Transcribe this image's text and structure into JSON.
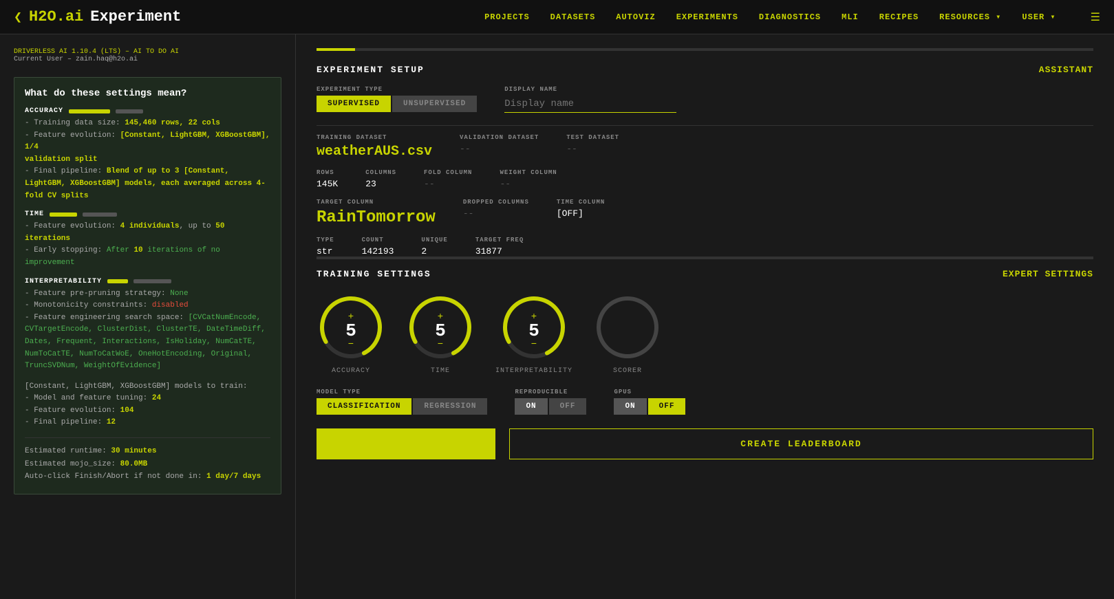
{
  "nav": {
    "logo": "H2O.ai",
    "page_title": "Experiment",
    "chevron": "❮",
    "links": [
      "PROJECTS",
      "DATASETS",
      "AUTOVIZ",
      "EXPERIMENTS",
      "DIAGNOSTICS",
      "MLI",
      "RECIPES",
      "RESOURCES ▾",
      "USER ▾"
    ]
  },
  "subtitle": {
    "driverless": "DRIVERLESS AI 1.10.4 (LTS) – AI TO DO AI",
    "user": "Current User – zain.haq@h2o.ai"
  },
  "info_panel": {
    "title": "What do these settings mean?",
    "accuracy": {
      "label": "ACCURACY",
      "bar1_width": "60",
      "bar2_width": "40",
      "line1": "- Training data size: 145,460 rows, 22 cols",
      "line2": "- Feature evolution: [Constant, LightGBM, XGBoostGBM], 1/4 validation split",
      "line3": "- Final pipeline: Blend of up to 3 [Constant, LightGBM, XGBoostGBM] models, each averaged across 4-fold CV splits"
    },
    "time": {
      "label": "TIME",
      "bar1_width": "40",
      "bar2_width": "50",
      "line1": "- Feature evolution: 4 individuals, up to 50 iterations",
      "line2": "- Early stopping: After 10 iterations of no improvement"
    },
    "interpretability": {
      "label": "INTERPRETABILITY",
      "bar1_width": "30",
      "bar2_width": "55",
      "line1": "- Feature pre-pruning strategy: None",
      "line2": "- Monotonicity constraints: disabled",
      "line3": "- Feature engineering search space: [CVCatNumEncode, CVTargetEncode, ClusterDist, ClusterTE, DateTimeDiff, Dates, Frequent, Interactions, IsHoliday, NumCatTE, NumToCatTE, NumToCatWoE, OneHotEncoding, Original, TruncSVDNum, WeightOfEvidence]"
    },
    "models": {
      "line1": "[Constant, LightGBM, XGBoostGBM] models to train:",
      "line2": "- Model and feature tuning: 24",
      "line3": "- Feature evolution: 104",
      "line4": "- Final pipeline: 12"
    },
    "estimated": {
      "runtime": "Estimated runtime: 30 minutes",
      "mojo_size": "Estimated mojo_size: 80.0MB",
      "autoclick": "Auto-click Finish/Abort if not done in: 1 day/7 days"
    }
  },
  "experiment_setup": {
    "title": "EXPERIMENT SETUP",
    "assistant_label": "ASSISTANT",
    "experiment_type": {
      "label": "EXPERIMENT TYPE",
      "supervised": "SUPERVISED",
      "unsupervised": "UNSUPERVISED"
    },
    "display_name": {
      "label": "DISPLAY NAME",
      "placeholder": "Display name"
    },
    "training_dataset": {
      "label": "TRAINING DATASET",
      "value": "weatherAUS.csv"
    },
    "validation_dataset": {
      "label": "VALIDATION DATASET",
      "value": "--"
    },
    "test_dataset": {
      "label": "TEST DATASET",
      "value": "--"
    },
    "rows": {
      "label": "ROWS",
      "value": "145K"
    },
    "columns": {
      "label": "COLUMNS",
      "value": "23"
    },
    "fold_column": {
      "label": "FOLD COLUMN",
      "value": "--"
    },
    "weight_column": {
      "label": "WEIGHT COLUMN",
      "value": "--"
    },
    "target_column": {
      "label": "TARGET COLUMN",
      "value": "RainTomorrow"
    },
    "dropped_columns": {
      "label": "DROPPED COLUMNS",
      "value": "--"
    },
    "time_column": {
      "label": "TIME COLUMN",
      "value": "[OFF]"
    },
    "type": {
      "label": "TYPE",
      "value": "str"
    },
    "count": {
      "label": "COUNT",
      "value": "142193"
    },
    "unique": {
      "label": "UNIQUE",
      "value": "2"
    },
    "target_freq": {
      "label": "TARGET FREQ",
      "value": "31877"
    }
  },
  "training_settings": {
    "title": "TRAINING SETTINGS",
    "expert_label": "EXPERT SETTINGS",
    "knobs": [
      {
        "label": "ACCURACY",
        "value": "5",
        "active": true
      },
      {
        "label": "TIME",
        "value": "5",
        "active": true
      },
      {
        "label": "INTERPRETABILITY",
        "value": "5",
        "active": true
      },
      {
        "label": "SCORER",
        "value": "",
        "active": false
      }
    ],
    "model_type": {
      "label": "MODEL TYPE",
      "classification": "CLASSIFICATION",
      "regression": "REGRESSION"
    },
    "reproducible": {
      "label": "REPRODUCIBLE",
      "on": "ON",
      "off": "OFF"
    },
    "gpus": {
      "label": "GPUS",
      "on": "ON",
      "off": "OFF"
    },
    "launch_label": "",
    "leaderboard_label": "CREATE LEADERBOARD"
  }
}
